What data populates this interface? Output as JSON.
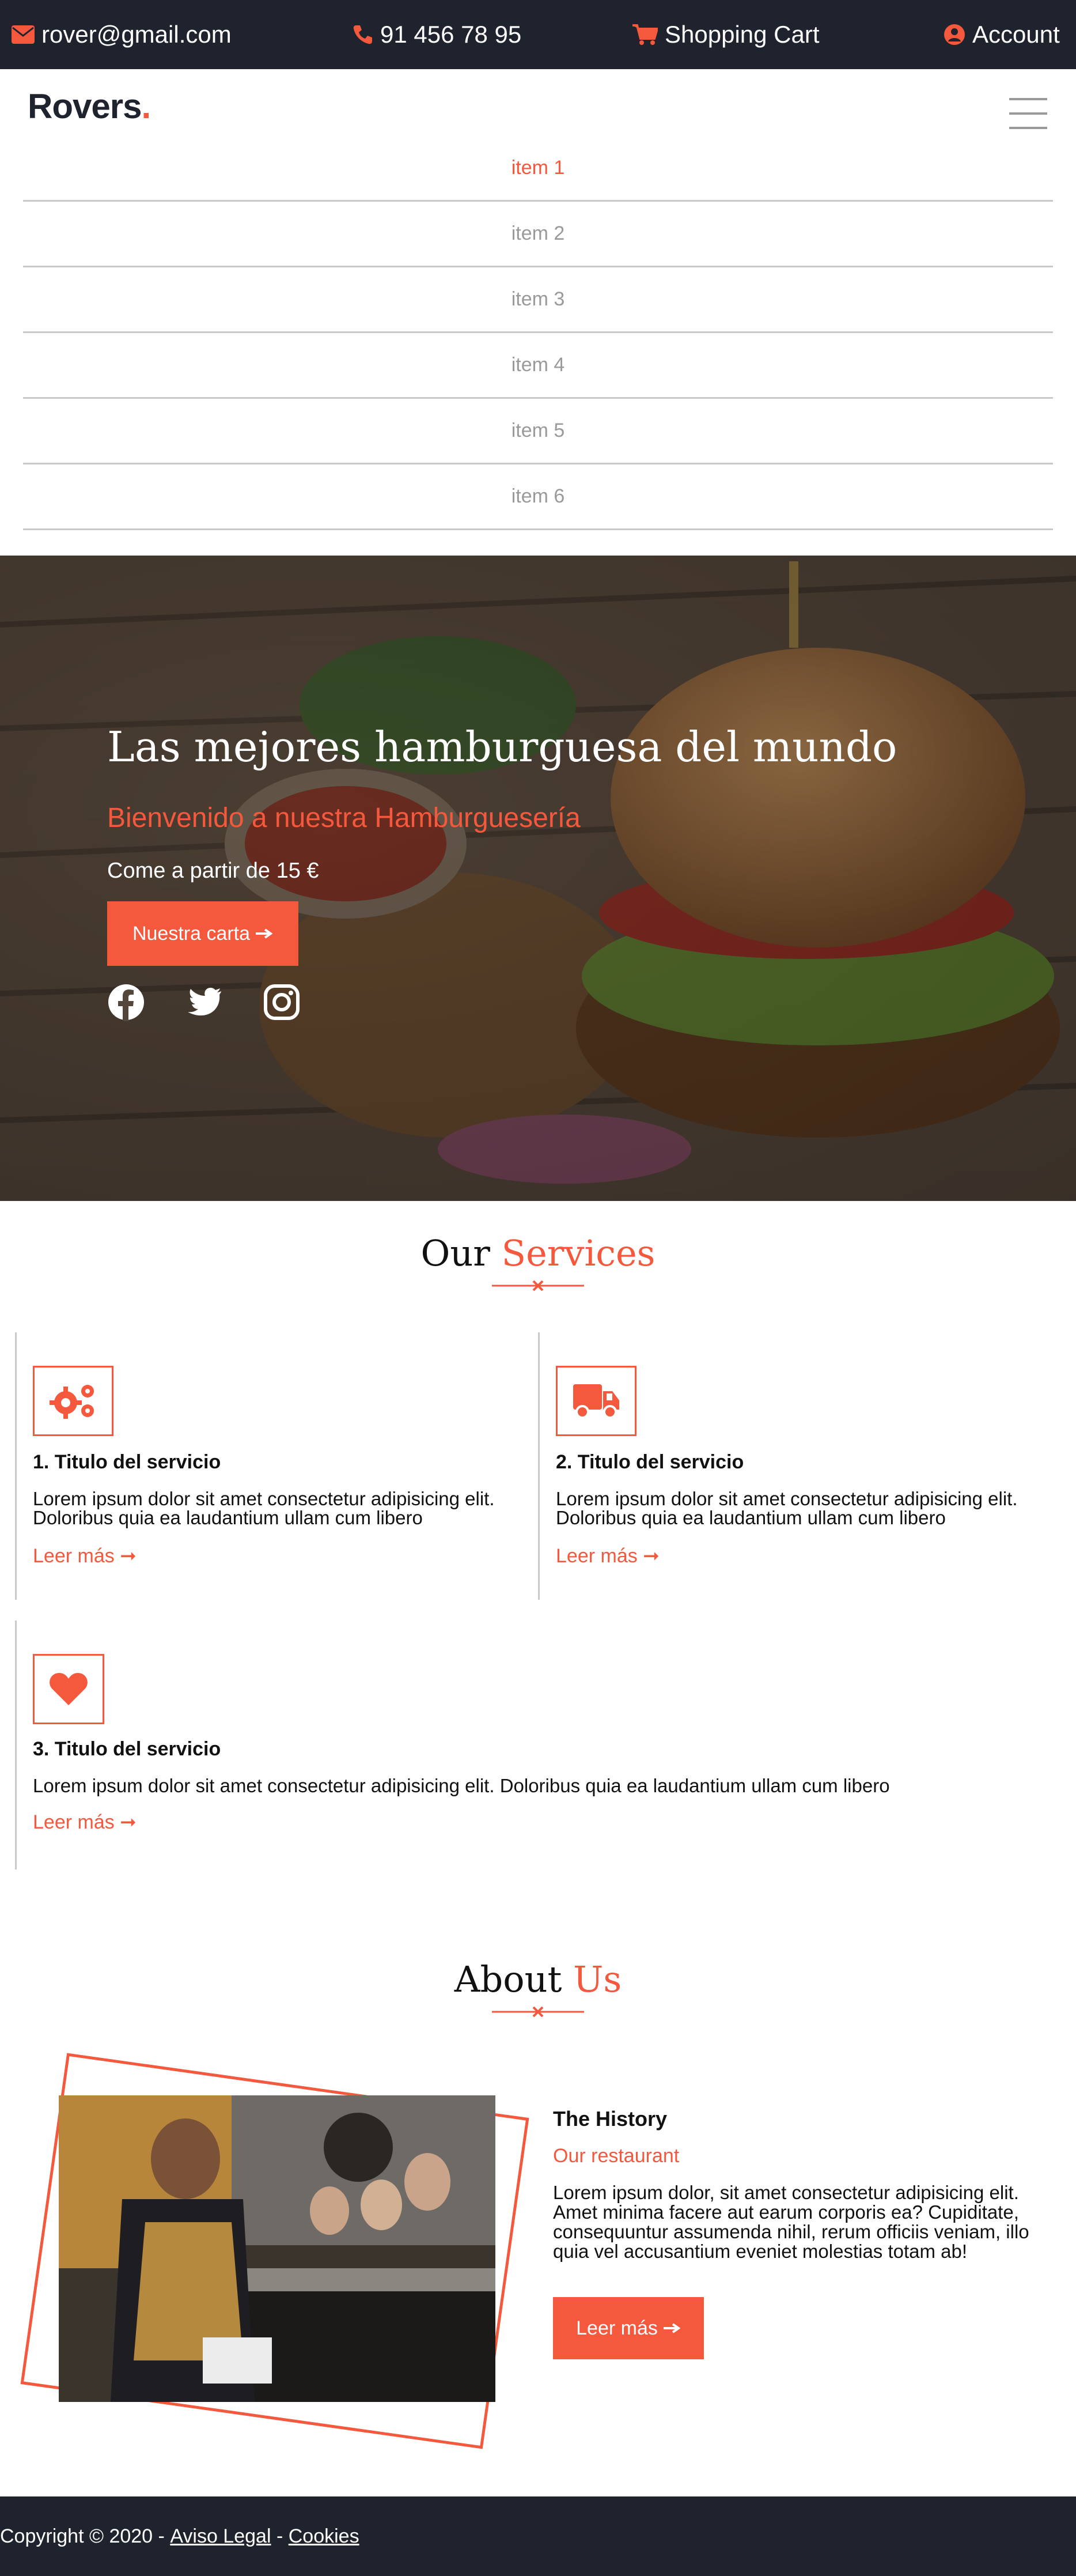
{
  "colors": {
    "accent": "#f4583d",
    "dark": "#1f232e",
    "nav_text": "#9a9a9a",
    "divider": "#c9c9c9"
  },
  "topbar": {
    "email": "rover@gmail.com",
    "email_icon": "envelope-icon",
    "phone": "91 456 78 95",
    "phone_icon": "phone-icon",
    "cart": "Shopping Cart",
    "cart_icon": "shopping-cart-icon",
    "account": "Account",
    "account_icon": "user-circle-icon"
  },
  "brand": {
    "name": "Rovers",
    "dot": "."
  },
  "nav": {
    "menu_icon": "hamburger-menu-icon",
    "items": [
      {
        "label": "item 1",
        "active": true
      },
      {
        "label": "item 2"
      },
      {
        "label": "item 3"
      },
      {
        "label": "item 4"
      },
      {
        "label": "item 5"
      },
      {
        "label": "item 6"
      }
    ]
  },
  "hero": {
    "title": "Las mejores hamburguesa del mundo",
    "subtitle": "Bienvenido a nuestra Hamburguesería",
    "price_text": "Come a partir de 15 €",
    "cta_label": "Nuestra carta",
    "cta_icon": "arrow-right-icon",
    "social": [
      "facebook-icon",
      "twitter-icon",
      "instagram-icon"
    ]
  },
  "services": {
    "title_main": "Our",
    "title_accent": "Services",
    "items": [
      {
        "title": "1. Titulo del servicio",
        "text": "Lorem ipsum dolor sit amet consectetur adipisicing elit. Doloribus quia ea laudantium ullam cum libero",
        "link": "Leer más",
        "icon": "gears-icon"
      },
      {
        "title": "2. Titulo del servicio",
        "text": "Lorem ipsum dolor sit amet consectetur adipisicing elit. Doloribus quia ea laudantium ullam cum libero",
        "link": "Leer más",
        "icon": "truck-icon"
      },
      {
        "title": "3. Titulo del servicio",
        "text": "Lorem ipsum dolor sit amet consectetur adipisicing elit. Doloribus quia ea laudantium ullam cum libero",
        "link": "Leer más",
        "icon": "heart-icon"
      }
    ]
  },
  "about": {
    "title_main": "About",
    "title_accent": "Us",
    "heading": "The History",
    "subheading": "Our restaurant",
    "text": "Lorem ipsum dolor, sit amet consectetur adipisicing elit. Amet minima facere aut earum corporis ea? Cupiditate, consequuntur assumenda nihil, rerum officiis veniam, illo quia vel accusantium eveniet molestias totam ab!",
    "button_label": "Leer más"
  },
  "footer": {
    "copyright": "Copyright © 2020 -",
    "legal": "Aviso Legal",
    "separator": "-",
    "cookies": "Cookies"
  }
}
